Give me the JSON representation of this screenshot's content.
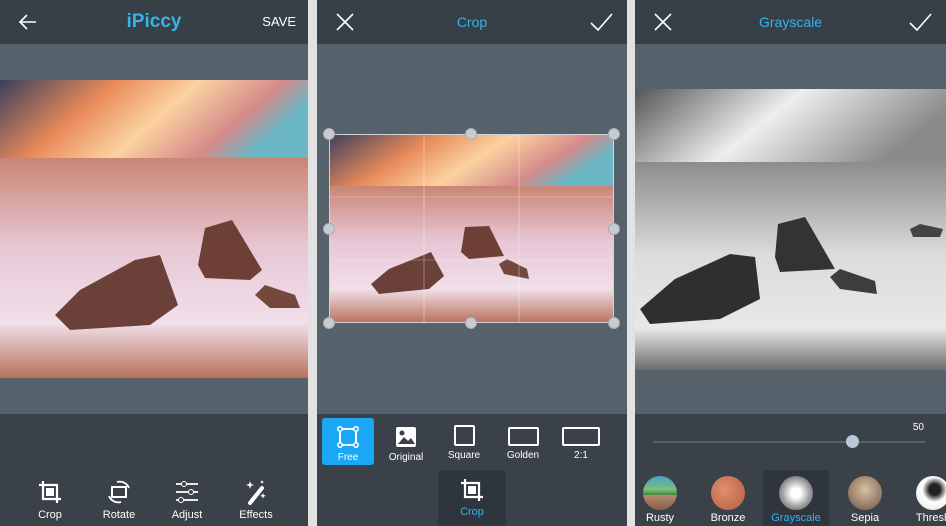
{
  "accent_color": "#35b3ec",
  "panels": [
    {
      "header": {
        "back_icon": "arrow-left-icon",
        "title": "iPiccy",
        "save_label": "SAVE"
      },
      "tools": [
        {
          "label": "Crop",
          "icon": "crop-icon"
        },
        {
          "label": "Rotate",
          "icon": "rotate-icon"
        },
        {
          "label": "Adjust",
          "icon": "sliders-icon"
        },
        {
          "label": "Effects",
          "icon": "magic-wand-icon"
        }
      ]
    },
    {
      "header": {
        "close_icon": "close-icon",
        "title": "Crop",
        "confirm_icon": "checkmark-icon"
      },
      "ratios": [
        {
          "label": "Free",
          "active": true
        },
        {
          "label": "Original",
          "active": false
        },
        {
          "label": "Square",
          "active": false
        },
        {
          "label": "Golden",
          "active": false
        },
        {
          "label": "2:1",
          "active": false
        }
      ],
      "active_tool": {
        "label": "Crop",
        "icon": "crop-icon"
      }
    },
    {
      "header": {
        "close_icon": "close-icon",
        "title": "Grayscale",
        "confirm_icon": "checkmark-icon"
      },
      "slider": {
        "value": "50",
        "position_fraction": 0.73
      },
      "filters": [
        {
          "label": "Rusty",
          "active": false
        },
        {
          "label": "Bronze",
          "active": false
        },
        {
          "label": "Grayscale",
          "active": true
        },
        {
          "label": "Sepia",
          "active": false
        },
        {
          "label": "Thresh",
          "active": false
        }
      ]
    }
  ]
}
